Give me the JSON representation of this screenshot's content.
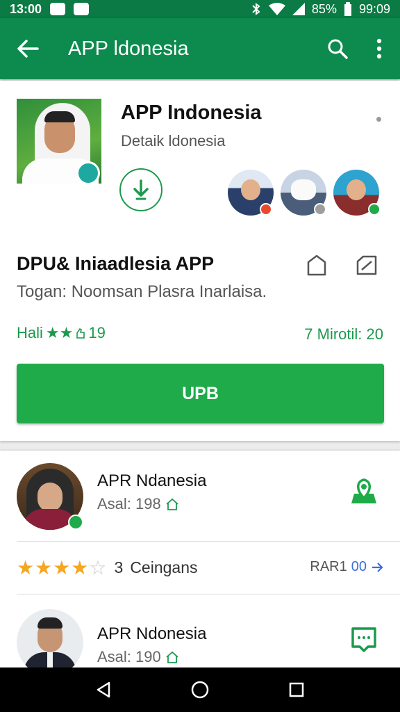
{
  "status": {
    "time": "13:00",
    "battery": "85%",
    "clock": "99:09"
  },
  "appbar": {
    "title": "APP ldonesia",
    "back_icon": "arrow-left-icon",
    "search_icon": "search-icon",
    "more_icon": "more-vert-icon"
  },
  "app": {
    "title": "APP Indonesia",
    "subtitle": "Detaik ldonesia",
    "section_title": "DPU& Iniaadlesia APP",
    "section_subtitle": "Togan: Noomsan Plasra Inarlaisa.",
    "rating_prefix": "Hali",
    "rating_stars": "★★",
    "rating_value": "19",
    "right_meta": "7 Mirotil: 20",
    "button_label": "UPB"
  },
  "list": [
    {
      "title": "APR Ndanesia",
      "meta": "Asal: 198"
    },
    {
      "title": "APR Ndonesia",
      "meta": "Asal: 190"
    }
  ],
  "review": {
    "stars_filled": "★★★★",
    "stars_empty": "☆",
    "count": "3",
    "label": "Ceingans",
    "right_label": "RAR1",
    "right_value": "00"
  },
  "colors": {
    "primary": "#0d8a4d",
    "accent": "#1fab4a",
    "star": "#f5a623"
  }
}
